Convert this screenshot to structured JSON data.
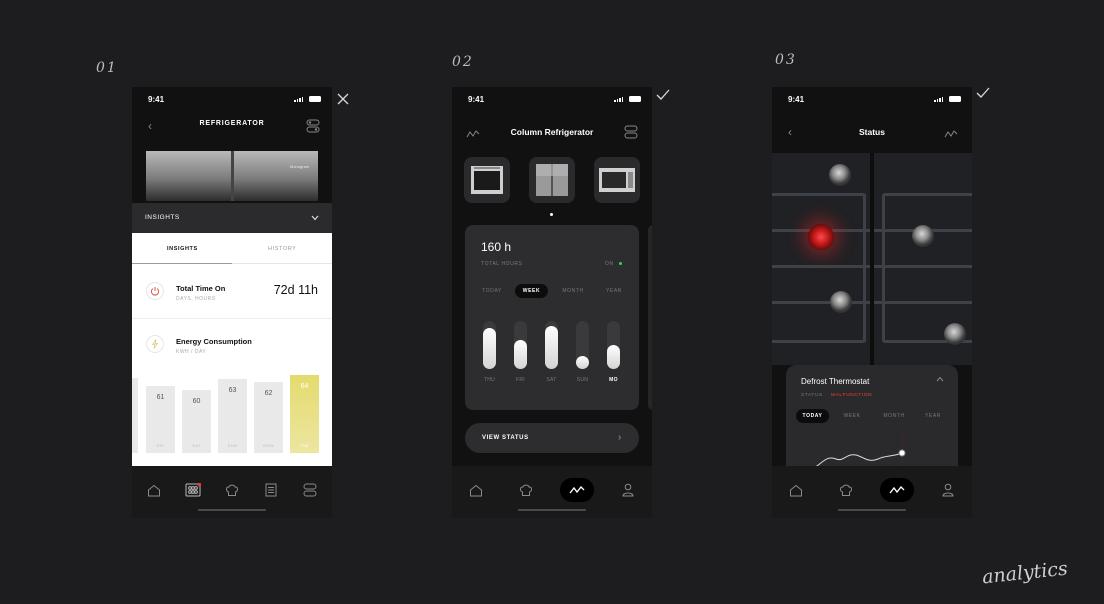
{
  "labels": {
    "s1": "01",
    "s2": "02",
    "s3": "03",
    "signature": "analytics"
  },
  "status_time": "9:41",
  "colors": {
    "accent_yellow": "#e4db6e",
    "malfunction_red": "#ff3c3c",
    "on_green": "#39d353",
    "background": "#1d1d1f"
  },
  "screen1": {
    "title": "REFRIGERATOR",
    "brand_text": "Monogram",
    "insights_header": "INSIGHTS",
    "tabs": [
      "INSIGHTS",
      "HISTORY"
    ],
    "metrics": [
      {
        "label": "Total Time On",
        "sub": "DAYS, HOURS",
        "value": "72d 11h",
        "icon": "power-icon"
      },
      {
        "label": "Energy Consumption",
        "sub": "KWH / DAY",
        "value": "",
        "icon": "bolt-icon"
      }
    ],
    "chart_data": {
      "type": "bar",
      "categories": [
        "FRI",
        "SAT",
        "SUN",
        "MON",
        "TUE"
      ],
      "values": [
        61,
        60,
        63,
        62,
        64
      ],
      "highlight": "TUE",
      "ylim": [
        55,
        65
      ]
    }
  },
  "screen2": {
    "title": "Column Refrigerator",
    "thumbnails": [
      "oven",
      "refrigerator",
      "microwave"
    ],
    "hours": "160 h",
    "hours_label": "TOTAL HOURS",
    "on_label": "ON",
    "periods": [
      "TODAY",
      "WEEK",
      "MONTH",
      "YEAR"
    ],
    "active_period": "WEEK",
    "chart_data": {
      "type": "bar",
      "categories": [
        "THU",
        "FRI",
        "SAT",
        "SUN",
        "MO"
      ],
      "values": [
        0.85,
        0.6,
        0.9,
        0.28,
        0.5
      ],
      "ylim": [
        0,
        1
      ]
    },
    "view_status": "VIEW STATUS"
  },
  "screen3": {
    "title": "Status",
    "popup_title": "Defrost Thermostat",
    "status_label": "STATUS",
    "status_value": "MALFUNCTION",
    "periods": [
      "TODAY",
      "WEEK",
      "MONTH",
      "YEAR"
    ],
    "active_period": "TODAY"
  }
}
